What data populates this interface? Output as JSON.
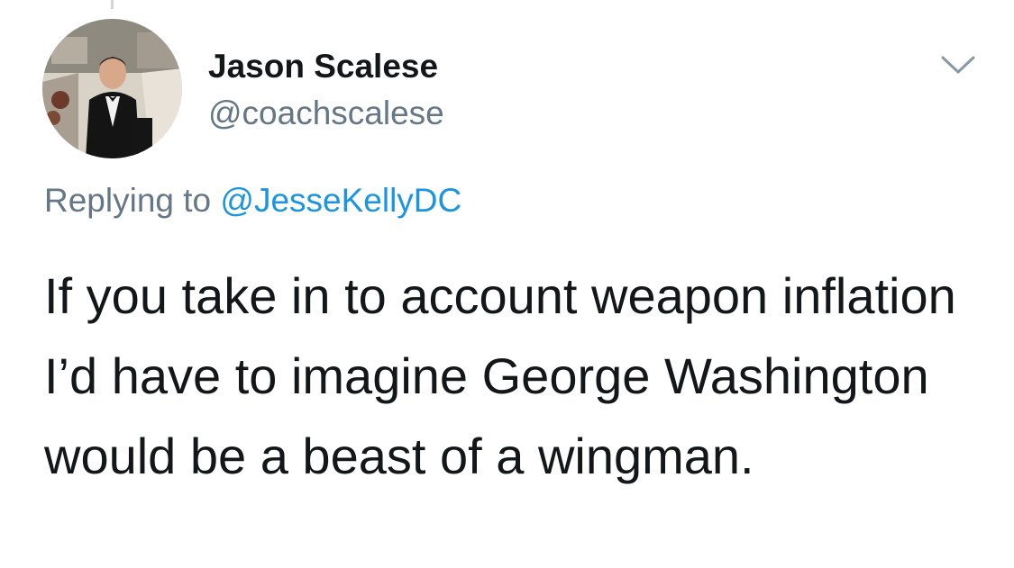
{
  "tweet": {
    "author": {
      "display_name": "Jason Scalese",
      "handle": "@coachscalese",
      "avatar": "profile-photo"
    },
    "reply": {
      "prefix": "Replying to",
      "mention": "@JesseKellyDC"
    },
    "text": "If you take in to account weapon inflation I’d have to imagine George Washington would be a beast of a wingman.",
    "menu_icon": "chevron-down-icon"
  },
  "colors": {
    "primary_text": "#14171a",
    "secondary_text": "#657786",
    "link": "#1b95e0",
    "background": "#ffffff"
  }
}
